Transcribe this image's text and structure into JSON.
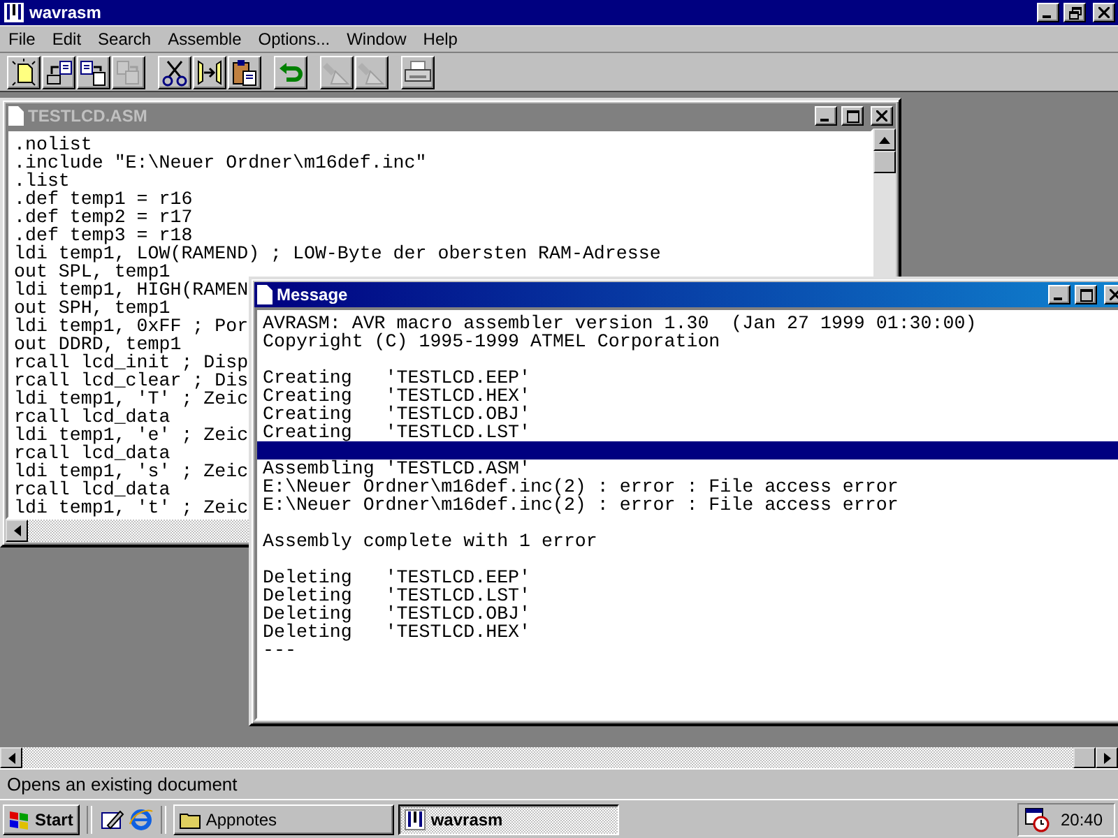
{
  "app": {
    "title": "wavrasm"
  },
  "menu": [
    {
      "label": "File"
    },
    {
      "label": "Edit"
    },
    {
      "label": "Search"
    },
    {
      "label": "Assemble"
    },
    {
      "label": "Options..."
    },
    {
      "label": "Window"
    },
    {
      "label": "Help"
    }
  ],
  "toolbar": [
    {
      "kind": "new",
      "disabled": false
    },
    {
      "kind": "open",
      "disabled": false
    },
    {
      "kind": "save",
      "disabled": false
    },
    {
      "kind": "saveall",
      "disabled": true
    },
    {
      "kind": "cut",
      "disabled": false
    },
    {
      "kind": "copy",
      "disabled": false
    },
    {
      "kind": "paste",
      "disabled": false
    },
    {
      "kind": "undo",
      "disabled": false
    },
    {
      "kind": "find",
      "disabled": true
    },
    {
      "kind": "find",
      "disabled": true
    },
    {
      "kind": "print",
      "disabled": false
    }
  ],
  "editor": {
    "title": "TESTLCD.ASM",
    "active": false,
    "lines": [
      ".nolist",
      ".include \"E:\\Neuer Ordner\\m16def.inc\"",
      ".list",
      ".def temp1 = r16",
      ".def temp2 = r17",
      ".def temp3 = r18",
      "ldi temp1, LOW(RAMEND) ; LOW-Byte der obersten RAM-Adresse",
      "out SPL, temp1",
      "ldi temp1, HIGH(RAMEN",
      "out SPH, temp1",
      "ldi temp1, 0xFF ; Por",
      "out DDRD, temp1",
      "rcall lcd_init ; Disp",
      "rcall lcd_clear ; Dis",
      "ldi temp1, 'T' ; Zeic",
      "rcall lcd_data",
      "ldi temp1, 'e' ; Zeic",
      "rcall lcd_data",
      "ldi temp1, 's' ; Zeic",
      "rcall lcd_data",
      "ldi temp1, 't' ; Zeic"
    ]
  },
  "message": {
    "title": "Message",
    "active": true,
    "lines": [
      {
        "text": "AVRASM: AVR macro assembler version 1.30  (Jan 27 1999 01:30:00)",
        "selected": false
      },
      {
        "text": "Copyright (C) 1995-1999 ATMEL Corporation",
        "selected": false
      },
      {
        "selected": false
      },
      {
        "text": "Creating   'TESTLCD.EEP'",
        "selected": false
      },
      {
        "text": "Creating   'TESTLCD.HEX'",
        "selected": false
      },
      {
        "text": "Creating   'TESTLCD.OBJ'",
        "selected": false
      },
      {
        "text": "Creating   'TESTLCD.LST'",
        "selected": false
      },
      {
        "selected": true
      },
      {
        "text": "Assembling 'TESTLCD.ASM'",
        "selected": false
      },
      {
        "text": "E:\\Neuer Ordner\\m16def.inc(2) : error : File access error",
        "selected": false
      },
      {
        "text": "E:\\Neuer Ordner\\m16def.inc(2) : error : File access error",
        "selected": false
      },
      {
        "selected": false
      },
      {
        "text": "Assembly complete with 1 error",
        "selected": false
      },
      {
        "selected": false
      },
      {
        "text": "Deleting   'TESTLCD.EEP'",
        "selected": false
      },
      {
        "text": "Deleting   'TESTLCD.LST'",
        "selected": false
      },
      {
        "text": "Deleting   'TESTLCD.OBJ'",
        "selected": false
      },
      {
        "text": "Deleting   'TESTLCD.HEX'",
        "selected": false
      },
      {
        "text": "---",
        "selected": false
      }
    ]
  },
  "status_bar": "Opens an existing document",
  "taskbar": {
    "start": "Start",
    "quick_launch": [
      {
        "kind": "desktop"
      },
      {
        "kind": "browser"
      }
    ],
    "tasks": [
      {
        "label": "Appnotes",
        "kind": "folder",
        "selected": false
      },
      {
        "label": "wavrasm",
        "kind": "app",
        "selected": true
      }
    ],
    "clock": "20:40"
  }
}
